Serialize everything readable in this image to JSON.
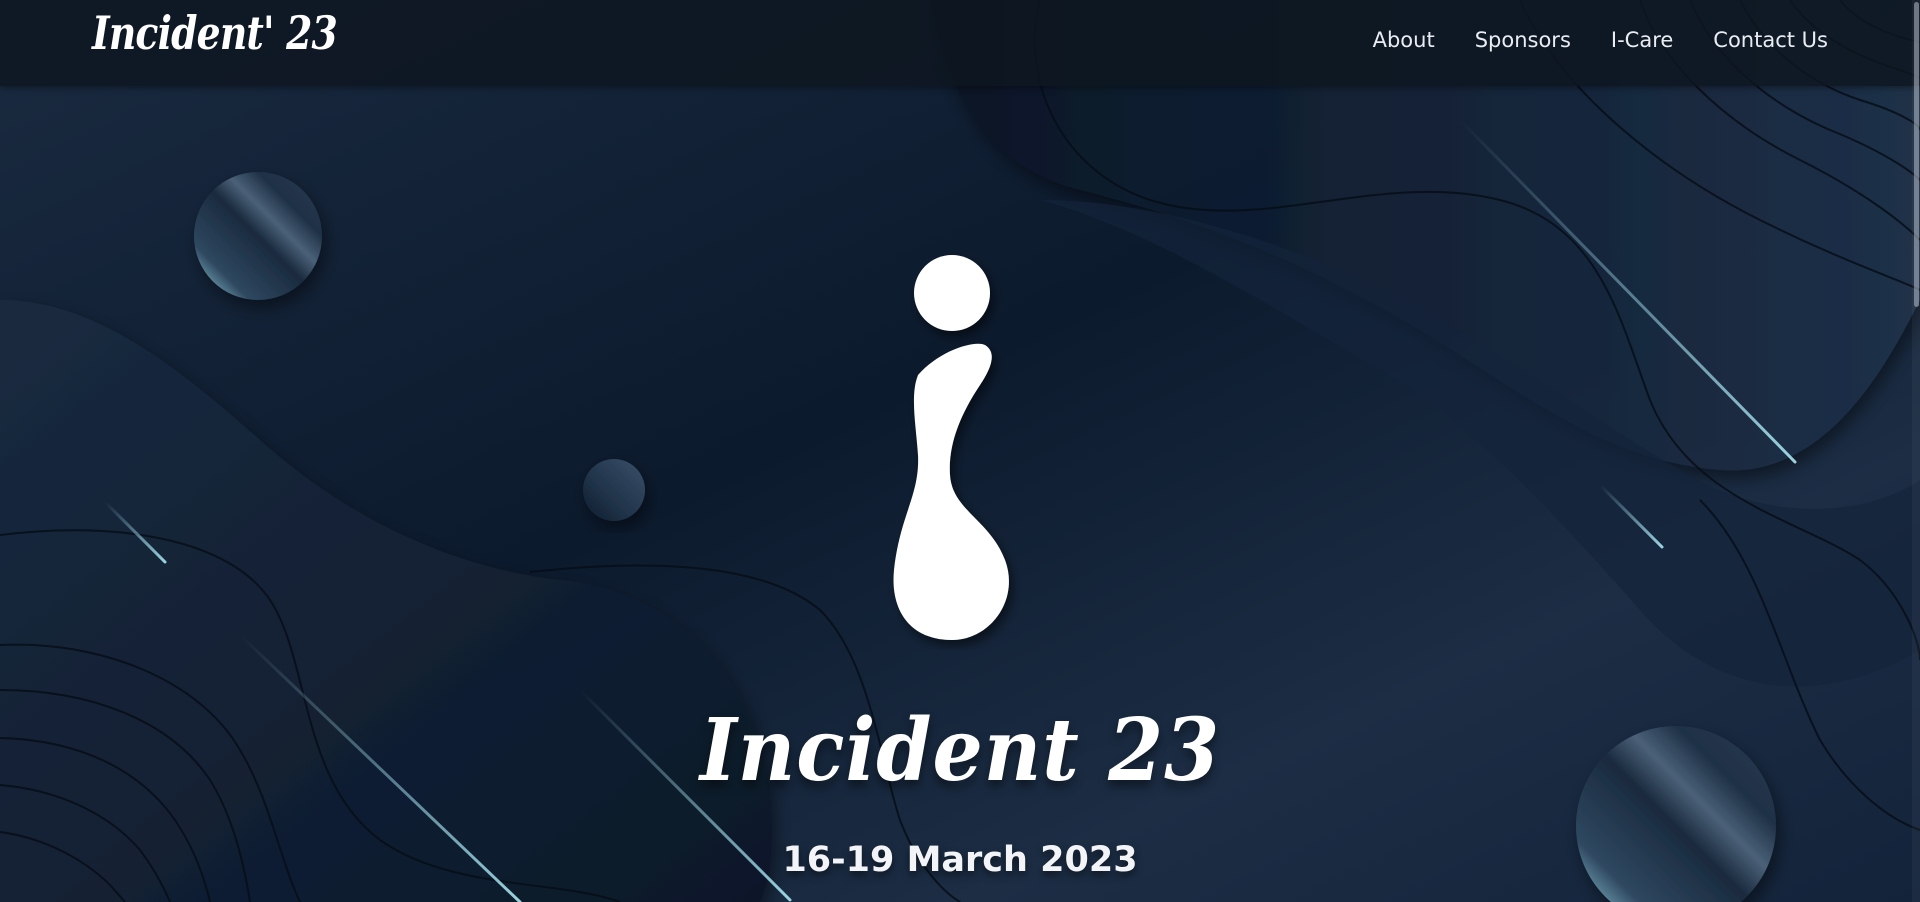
{
  "nav": {
    "brand": "Incident' 23",
    "links": [
      "About",
      "Sponsors",
      "I-Care",
      "Contact Us"
    ]
  },
  "hero": {
    "title": "Incident 23",
    "date": "16-19 March 2023"
  },
  "colors": {
    "background": "#0d1b2e",
    "navbar": "#0e1620",
    "text": "#ffffff",
    "accent_glow": "#a9e6f2"
  },
  "icons": [
    "i-logo-icon"
  ]
}
